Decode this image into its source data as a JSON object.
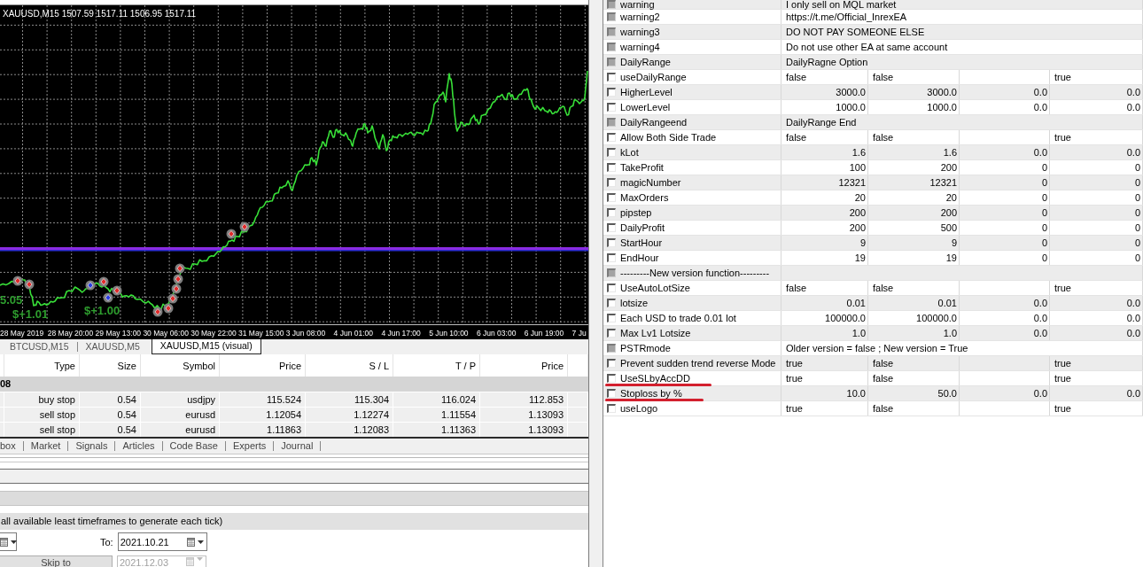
{
  "chart": {
    "title": "XAUUSD,M15 1507.59 1517.11 1506.95 1517.11",
    "profit_labels": [
      "5.05",
      "$+1.01",
      "$+1.00"
    ],
    "time_labels": [
      "28 May 2019",
      "28 May 20:00",
      "29 May 13:00",
      "30 May 06:00",
      "30 May 22:00",
      "31 May 15:00",
      "3 Jun 08:00",
      "4 Jun 01:00",
      "4 Jun 17:00",
      "5 Jun 10:00",
      "6 Jun 03:00",
      "6 Jun 19:00",
      "7 Ju"
    ]
  },
  "chart_tabs": [
    {
      "label": "BTCUSD,M15",
      "selected": false
    },
    {
      "label": "XAUUSD,M5",
      "selected": false
    },
    {
      "label": "XAUUSD,M15 (visual)",
      "selected": true
    }
  ],
  "orders": {
    "columns": [
      "Type",
      "Size",
      "Symbol",
      "Price",
      "S / L",
      "T / P",
      "Price"
    ],
    "group": "08",
    "rows": [
      [
        "buy stop",
        "0.54",
        "usdjpy",
        "115.524",
        "115.304",
        "116.024",
        "112.853"
      ],
      [
        "sell stop",
        "0.54",
        "eurusd",
        "1.12054",
        "1.12274",
        "1.11554",
        "1.13093"
      ],
      [
        "sell stop",
        "0.54",
        "eurusd",
        "1.11863",
        "1.12083",
        "1.11363",
        "1.13093"
      ]
    ]
  },
  "terminal_tabs": [
    {
      "label": "box",
      "selected": false
    },
    {
      "label": "Market",
      "selected": false
    },
    {
      "label": "Signals",
      "selected": false
    },
    {
      "label": "Articles",
      "selected": false
    },
    {
      "label": "Code Base",
      "selected": false
    },
    {
      "label": "Experts",
      "selected": false
    },
    {
      "label": "Journal",
      "selected": false
    }
  ],
  "tester": {
    "model": "all available least timeframes to generate each tick)",
    "to_label": "To:",
    "to_field": {
      "value": "2021.10.21",
      "disabled": false
    },
    "skip_button": "Skip to",
    "skip_field": {
      "value": "2021.12.03",
      "disabled": true
    }
  },
  "inputs": {
    "rows": [
      {
        "name": "warning",
        "kind": "string",
        "checked": false,
        "underlined": false,
        "value": "I only sell on MQL market"
      },
      {
        "name": "warning2",
        "kind": "string",
        "checked": false,
        "underlined": false,
        "value": "https://t.me/Official_InrexEA"
      },
      {
        "name": "warning3",
        "kind": "string",
        "checked": false,
        "underlined": false,
        "value": "DO NOT PAY SOMEONE ELSE"
      },
      {
        "name": "warning4",
        "kind": "string",
        "checked": false,
        "underlined": false,
        "value": "Do not use other EA at same account"
      },
      {
        "name": "DailyRange",
        "kind": "string",
        "checked": false,
        "underlined": false,
        "value": "DailyRagne Option"
      },
      {
        "name": "useDailyRange",
        "kind": "bool",
        "checked": false,
        "underlined": false,
        "value": "false",
        "start": "false",
        "stop": "true"
      },
      {
        "name": "HigherLevel",
        "kind": "number",
        "checked": false,
        "underlined": false,
        "value": "3000.0",
        "start": "3000.0",
        "step": "0.0",
        "stop": "0.0"
      },
      {
        "name": "LowerLevel",
        "kind": "number",
        "checked": false,
        "underlined": false,
        "value": "1000.0",
        "start": "1000.0",
        "step": "0.0",
        "stop": "0.0"
      },
      {
        "name": "DailyRangeend",
        "kind": "string",
        "checked": false,
        "underlined": false,
        "value": "DailyRange End"
      },
      {
        "name": "Allow Both Side Trade",
        "kind": "bool",
        "checked": false,
        "underlined": false,
        "value": "false",
        "start": "false",
        "stop": "true"
      },
      {
        "name": "kLot",
        "kind": "number",
        "checked": false,
        "underlined": false,
        "value": "1.6",
        "start": "1.6",
        "step": "0.0",
        "stop": "0.0"
      },
      {
        "name": "TakeProfit",
        "kind": "number",
        "checked": false,
        "underlined": false,
        "value": "100",
        "start": "200",
        "step": "0",
        "stop": "0"
      },
      {
        "name": "magicNumber",
        "kind": "number",
        "checked": false,
        "underlined": false,
        "value": "12321",
        "start": "12321",
        "step": "0",
        "stop": "0"
      },
      {
        "name": "MaxOrders",
        "kind": "number",
        "checked": false,
        "underlined": false,
        "value": "20",
        "start": "20",
        "step": "0",
        "stop": "0"
      },
      {
        "name": "pipstep",
        "kind": "number",
        "checked": false,
        "underlined": false,
        "value": "200",
        "start": "200",
        "step": "0",
        "stop": "0"
      },
      {
        "name": "DailyProfit",
        "kind": "number",
        "checked": false,
        "underlined": false,
        "value": "200",
        "start": "500",
        "step": "0",
        "stop": "0"
      },
      {
        "name": "StartHour",
        "kind": "number",
        "checked": false,
        "underlined": false,
        "value": "9",
        "start": "9",
        "step": "0",
        "stop": "0"
      },
      {
        "name": "EndHour",
        "kind": "number",
        "checked": false,
        "underlined": false,
        "value": "19",
        "start": "19",
        "step": "0",
        "stop": "0"
      },
      {
        "name": "---------New version function---------",
        "kind": "string",
        "checked": false,
        "underlined": false
      },
      {
        "name": "UseAutoLotSize",
        "kind": "bool",
        "checked": false,
        "underlined": false,
        "value": "false",
        "start": "false",
        "stop": "true"
      },
      {
        "name": "lotsize",
        "kind": "number",
        "checked": false,
        "underlined": false,
        "value": "0.01",
        "start": "0.01",
        "step": "0.0",
        "stop": "0.0"
      },
      {
        "name": "Each USD to trade 0.01 lot",
        "kind": "number",
        "checked": false,
        "underlined": false,
        "value": "100000.0",
        "start": "100000.0",
        "step": "0.0",
        "stop": "0.0"
      },
      {
        "name": "Max Lv1 Lotsize",
        "kind": "number",
        "checked": false,
        "underlined": false,
        "value": "1.0",
        "start": "1.0",
        "step": "0.0",
        "stop": "0.0"
      },
      {
        "name": "PSTRmode",
        "kind": "string",
        "checked": false,
        "underlined": false,
        "value": "Older version = false ; New version = True"
      },
      {
        "name": "Prevent sudden trend reverse Mode",
        "kind": "bool",
        "checked": false,
        "underlined": false,
        "value": "true",
        "start": "false",
        "stop": "true"
      },
      {
        "name": "UseSLbyAccDD",
        "kind": "bool",
        "checked": false,
        "underlined": true,
        "value": "true",
        "start": "false",
        "stop": "true"
      },
      {
        "name": "Stoploss by %",
        "kind": "number",
        "checked": false,
        "underlined": true,
        "value": "10.0",
        "start": "50.0",
        "step": "0.0",
        "stop": "0.0"
      },
      {
        "name": "useLogo",
        "kind": "bool",
        "checked": false,
        "underlined": false,
        "value": "true",
        "start": "false",
        "stop": "true"
      }
    ]
  }
}
